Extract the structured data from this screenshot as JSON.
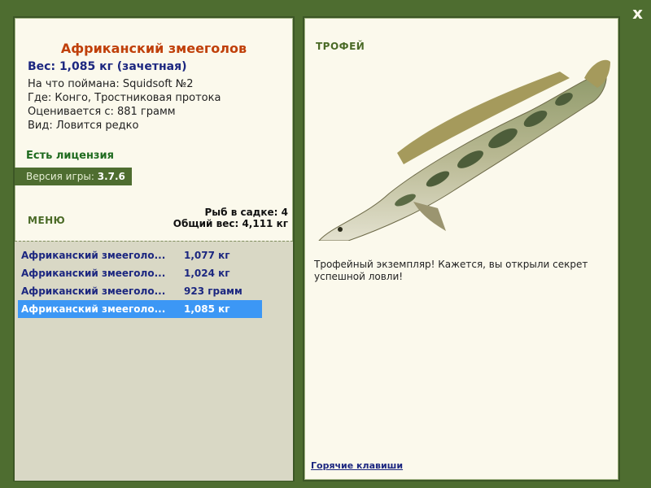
{
  "window": {
    "close_label": "x"
  },
  "fish": {
    "title": "Африканский змееголов",
    "weight": "Вес: 1,085 кг (зачетная)",
    "bait": "На что поймана: Squidsoft №2",
    "location": "Где: Конго, Тростниковая протока",
    "estimated": "Оценивается с: 881 грамм",
    "rarity": "Вид: Ловится редко"
  },
  "license": "Есть лицензия",
  "version": {
    "label": "Версия игры:",
    "value": "3.7.6"
  },
  "menu_label": "МЕНЮ",
  "stats": {
    "count": "Рыб в садке: 4",
    "total": "Общий вес: 4,111 кг"
  },
  "catches": [
    {
      "name": "Африканский змееголо...",
      "weight": "1,077 кг"
    },
    {
      "name": "Африканский змееголо...",
      "weight": "1,024 кг"
    },
    {
      "name": "Африканский змееголо...",
      "weight": "923 грамм"
    },
    {
      "name": "Африканский змееголо...",
      "weight": "1,085 кг"
    }
  ],
  "trophy": {
    "label": "ТРОФЕЙ",
    "description": "Трофейный экземпляр! Кажется, вы открыли секрет успешной ловли!"
  },
  "hotkeys_label": "Горячие клавиши"
}
